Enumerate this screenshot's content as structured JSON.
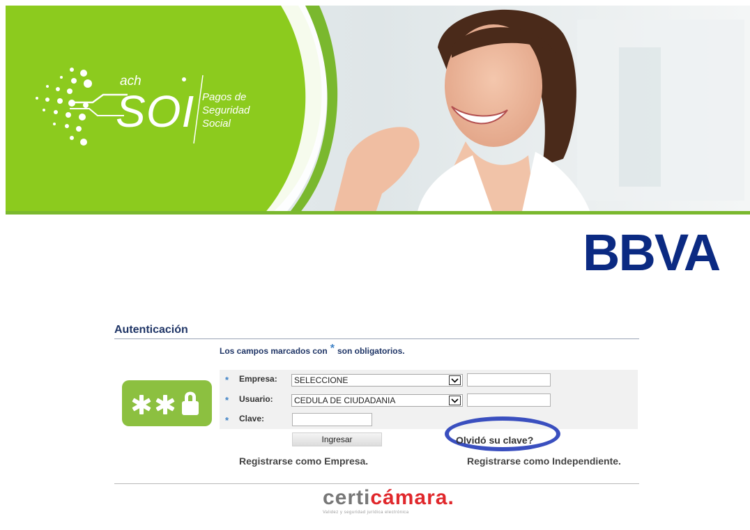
{
  "banner": {
    "logo_ach": "ach",
    "logo_soi": "SOI",
    "logo_tagline": "Pagos de Seguridad Social"
  },
  "bank": {
    "name": "BBVA",
    "color": "#0b2a82"
  },
  "auth": {
    "title": "Autenticación",
    "required_prefix": "Los campos marcados con",
    "required_star": "*",
    "required_suffix": "son obligatorios.",
    "fields": {
      "empresa_label": "Empresa:",
      "empresa_value": "SELECCIONE",
      "usuario_label": "Usuario:",
      "usuario_value": "CEDULA DE CIUDADANIA",
      "clave_label": "Clave:"
    },
    "login_button": "Ingresar",
    "forgot_link": "Olvidó su clave?",
    "register_company": "Registrarse como Empresa.",
    "register_independent": "Registrarse como Independiente."
  },
  "footer": {
    "brand_prefix": "certi",
    "brand_accent": "cámara.",
    "tagline": "Validez y seguridad jurídica electrónica"
  },
  "colors": {
    "brand_green": "#8ccb1e",
    "highlight_oval": "#3a4fbf"
  }
}
